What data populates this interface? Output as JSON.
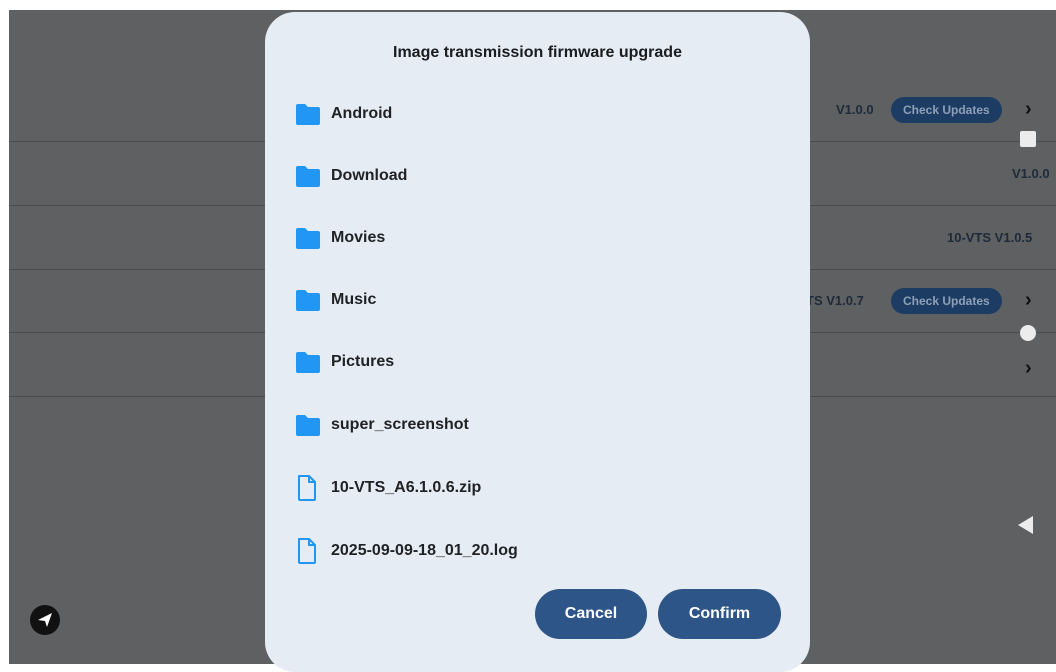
{
  "background": {
    "rows": [
      {
        "version": "V1.0.0",
        "button": "Check Updates",
        "chevron": "›"
      },
      {
        "version": "V1.0.0"
      },
      {
        "version": "10-VTS V1.0.5"
      },
      {
        "version": "TS V1.0.7",
        "button": "Check Updates",
        "chevron": "›"
      },
      {
        "chevron": "›"
      }
    ]
  },
  "dialog": {
    "title": "Image transmission firmware upgrade",
    "items": [
      {
        "name": "Android",
        "icon": "folder-icon"
      },
      {
        "name": "Download",
        "icon": "folder-icon"
      },
      {
        "name": "Movies",
        "icon": "folder-icon"
      },
      {
        "name": "Music",
        "icon": "folder-icon"
      },
      {
        "name": "Pictures",
        "icon": "folder-icon"
      },
      {
        "name": "super_screenshot",
        "icon": "folder-icon"
      },
      {
        "name": "10-VTS_A6.1.0.6.zip",
        "icon": "file-icon"
      },
      {
        "name": "2025-09-09-18_01_20.log",
        "icon": "file-icon"
      }
    ],
    "cancel_label": "Cancel",
    "confirm_label": "Confirm"
  },
  "colors": {
    "dialog_bg": "#e6ecf4",
    "folder": "#2196f3",
    "button": "#2d5587",
    "scrim": "#5f6062"
  }
}
